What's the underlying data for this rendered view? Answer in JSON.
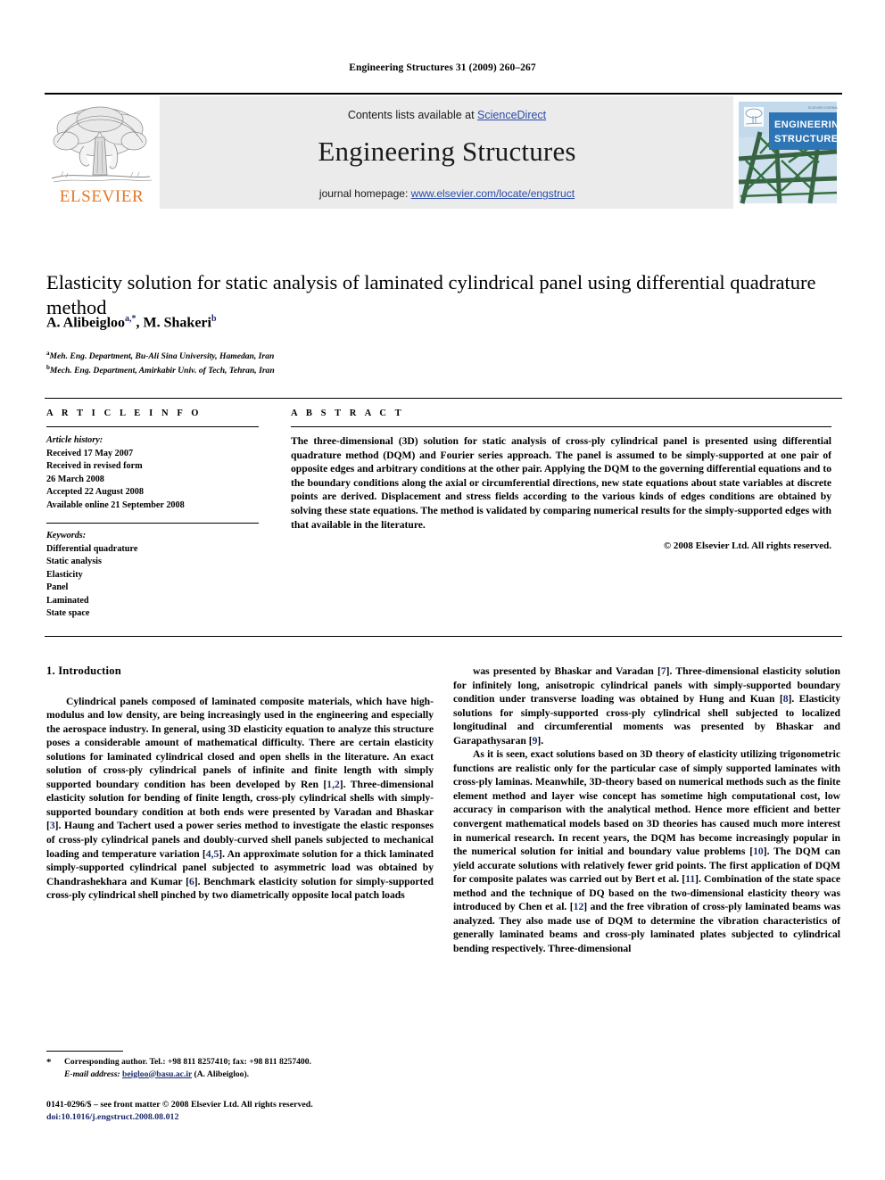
{
  "running_head": "Engineering Structures 31 (2009) 260–267",
  "masthead": {
    "contents_prefix": "Contents lists available at ",
    "contents_link": "ScienceDirect",
    "journal_name": "Engineering Structures",
    "homepage_prefix": "journal homepage: ",
    "homepage_url": "www.elsevier.com/locate/engstruct",
    "publisher_wordmark": "ELSEVIER",
    "cover_title_line1": "ENGINEERING",
    "cover_title_line2": "STRUCTURES",
    "accent_orange": "#E87722",
    "link_blue": "#2B4BA8",
    "band_gray": "#EBEBEB",
    "cover_blue": "#2E75B6"
  },
  "article": {
    "title": "Elasticity solution for static analysis of laminated cylindrical panel using differential quadrature method",
    "authors_html": "A. Alibeigloo<sup>a,*</sup>, M. Shakeri<sup>b</sup>",
    "affiliation_a": "Meh. Eng. Department, Bu-Ali Sina University, Hamedan, Iran",
    "affiliation_b": "Mech. Eng. Department, Amirkabir Univ. of Tech, Tehran, Iran"
  },
  "article_info": {
    "heading": "A R T I C L E   I N F O",
    "history_label": "Article history:",
    "history_lines": [
      "Received 17 May 2007",
      "Received in revised form",
      "26 March 2008",
      "Accepted 22 August 2008",
      "Available online 21 September 2008"
    ],
    "keywords_label": "Keywords:",
    "keywords": [
      "Differential quadrature",
      "Static analysis",
      "Elasticity",
      "Panel",
      "Laminated",
      "State space"
    ]
  },
  "abstract": {
    "heading": "A B S T R A C T",
    "text": "The three-dimensional (3D) solution for static analysis of cross-ply cylindrical panel is presented using differential quadrature method (DQM) and Fourier series approach. The panel is assumed to be simply-supported at one pair of opposite edges and arbitrary conditions at the other pair. Applying the DQM to the governing differential equations and to the boundary conditions along the axial or circumferential directions, new state equations about state variables at discrete points are derived. Displacement and stress fields according to the various kinds of edges conditions are obtained by solving these state equations. The method is validated by comparing numerical results for the simply-supported edges with that available in the literature.",
    "copyright": "© 2008 Elsevier Ltd. All rights reserved."
  },
  "body": {
    "section_heading": "1. Introduction",
    "left_paragraph_1": "Cylindrical panels composed of laminated composite materials, which have high-modulus and low density, are being increasingly used in the engineering and especially the aerospace industry. In general, using 3D elasticity equation to analyze this structure poses a considerable amount of mathematical difficulty. There are certain elasticity solutions for laminated cylindrical closed and open shells in the literature. An exact solution of cross-ply cylindrical panels of infinite and finite length with simply supported boundary condition has been developed by Ren [1,2]. Three-dimensional elasticity solution for bending of finite length, cross-ply cylindrical shells with simply-supported boundary condition at both ends were presented by Varadan and Bhaskar [3]. Haung and Tachert used a power series method to investigate the elastic responses of cross-ply cylindrical panels and doubly-curved shell panels subjected to mechanical loading and temperature variation [4,5]. An approximate solution for a thick laminated simply-supported cylindrical panel subjected to asymmetric load was obtained by Chandrashekhara and Kumar [6]. Benchmark elasticity solution for simply-supported cross-ply cylindrical shell pinched by two diametrically opposite local patch loads",
    "right_paragraph_1": "was presented by Bhaskar and Varadan [7]. Three-dimensional elasticity solution for infinitely long, anisotropic cylindrical panels with simply-supported boundary condition under transverse loading was obtained by Hung and Kuan [8]. Elasticity solutions for simply-supported cross-ply cylindrical shell subjected to localized longitudinal and circumferential moments was presented by Bhaskar and Garapathysaran [9].",
    "right_paragraph_2": "As it is seen, exact solutions based on 3D theory of elasticity utilizing trigonometric functions are realistic only for the particular case of simply supported laminates with cross-ply laminas. Meanwhile, 3D-theory based on numerical methods such as the finite element method and layer wise concept has sometime high computational cost, low accuracy in comparison with the analytical method. Hence more efficient and better convergent mathematical models based on 3D theories has caused much more interest in numerical research. In recent years, the DQM has become increasingly popular in the numerical solution for initial and boundary value problems [10]. The DQM can yield accurate solutions with relatively fewer grid points. The first application of DQM for composite palates was carried out by Bert et al. [11]. Combination of the state space method and the technique of DQ based on the two-dimensional elasticity theory was introduced by Chen et al. [12] and the free vibration of cross-ply laminated beams was analyzed. They also made use of DQM to determine the vibration characteristics of generally laminated beams and cross-ply laminated plates subjected to cylindrical bending respectively. Three-dimensional"
  },
  "footnote": {
    "star": "*",
    "corresponding": "Corresponding author. Tel.: +98 811 8257410; fax: +98 811 8257400.",
    "email_label": "E-mail address:",
    "email": "beigloo@basu.ac.ir",
    "email_owner": "(A. Alibeigloo)."
  },
  "footer": {
    "front_matter": "0141-0296/$ – see front matter © 2008 Elsevier Ltd. All rights reserved.",
    "doi": "doi:10.1016/j.engstruct.2008.08.012"
  }
}
